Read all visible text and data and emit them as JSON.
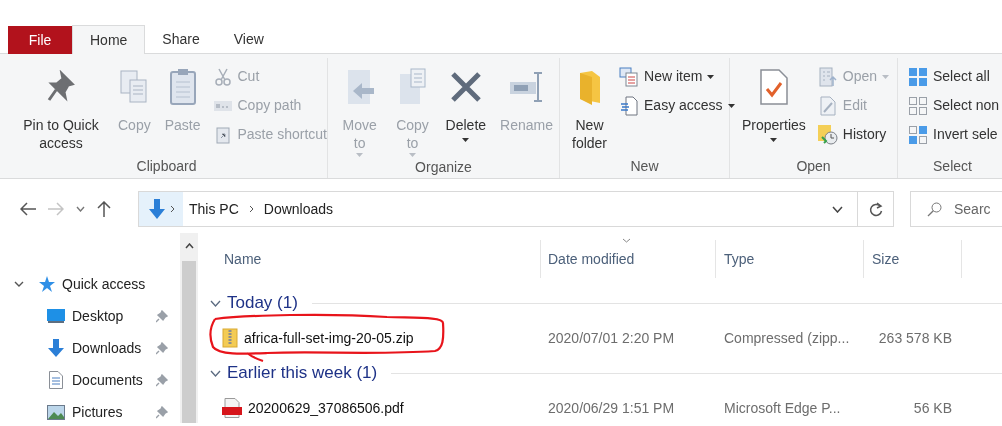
{
  "tabs": [
    {
      "label": "File",
      "kind": "file",
      "selected": false
    },
    {
      "label": "Home",
      "kind": "tab",
      "selected": true
    },
    {
      "label": "Share",
      "kind": "tab",
      "selected": false
    },
    {
      "label": "View",
      "kind": "tab",
      "selected": false
    }
  ],
  "ribbon": [
    {
      "label": "Clipboard",
      "items": [
        {
          "kind": "large",
          "label": "Pin to Quick access",
          "disabled": false,
          "dropdown": false
        },
        {
          "kind": "large",
          "label": "Copy",
          "disabled": true,
          "dropdown": false
        },
        {
          "kind": "large",
          "label": "Paste",
          "disabled": true,
          "dropdown": false
        },
        {
          "kind": "small",
          "label": "Cut",
          "disabled": true,
          "dropdown": false
        },
        {
          "kind": "small",
          "label": "Copy path",
          "disabled": true,
          "dropdown": false
        },
        {
          "kind": "small",
          "label": "Paste shortcut",
          "disabled": true,
          "dropdown": false
        }
      ]
    },
    {
      "label": "Organize",
      "items": [
        {
          "kind": "large",
          "label": "Move to",
          "disabled": true,
          "dropdown": true
        },
        {
          "kind": "large",
          "label": "Copy to",
          "disabled": true,
          "dropdown": true
        },
        {
          "kind": "large",
          "label": "Delete",
          "disabled": false,
          "dropdown": true
        },
        {
          "kind": "large",
          "label": "Rename",
          "disabled": true,
          "dropdown": false
        }
      ]
    },
    {
      "label": "New",
      "items": [
        {
          "kind": "large",
          "label": "New folder",
          "disabled": false,
          "dropdown": false
        },
        {
          "kind": "small",
          "label": "New item",
          "disabled": false,
          "dropdown": true
        },
        {
          "kind": "small",
          "label": "Easy access",
          "disabled": false,
          "dropdown": true
        }
      ]
    },
    {
      "label": "Open",
      "items": [
        {
          "kind": "large",
          "label": "Properties",
          "disabled": false,
          "dropdown": true
        },
        {
          "kind": "small",
          "label": "Open",
          "disabled": true,
          "dropdown": true
        },
        {
          "kind": "small",
          "label": "Edit",
          "disabled": true,
          "dropdown": false
        },
        {
          "kind": "small",
          "label": "History",
          "disabled": false,
          "dropdown": false
        }
      ]
    },
    {
      "label": "Select",
      "items": [
        {
          "kind": "small",
          "label": "Select all",
          "disabled": false,
          "dropdown": false
        },
        {
          "kind": "small",
          "label": "Select non",
          "disabled": false,
          "dropdown": false
        },
        {
          "kind": "small",
          "label": "Invert sele",
          "disabled": false,
          "dropdown": false
        }
      ]
    }
  ],
  "address": {
    "path": [
      "This PC",
      "Downloads"
    ],
    "search_placeholder": "Searc"
  },
  "navigation": [
    {
      "label": "Quick access",
      "expanded": true,
      "children": [
        {
          "label": "Desktop",
          "pinned": true
        },
        {
          "label": "Downloads",
          "pinned": true
        },
        {
          "label": "Documents",
          "pinned": true
        },
        {
          "label": "Pictures",
          "pinned": true
        }
      ]
    }
  ],
  "columns": [
    "Name",
    "Date modified",
    "Type",
    "Size"
  ],
  "groups": [
    {
      "label": "Today (1)",
      "expanded": true,
      "files": [
        {
          "kind": "zip",
          "name": "africa-full-set-img-20-05.zip",
          "date": "2020/07/01 2:20 PM",
          "type": "Compressed (zipp...",
          "size": "263 578 KB",
          "annotated": true
        }
      ]
    },
    {
      "label": "Earlier this week (1)",
      "expanded": true,
      "files": [
        {
          "kind": "pdf",
          "name": "20200629_37086506.pdf",
          "date": "2020/06/29 1:51 PM",
          "type": "Microsoft Edge P...",
          "size": "56 KB",
          "annotated": false
        }
      ]
    }
  ]
}
